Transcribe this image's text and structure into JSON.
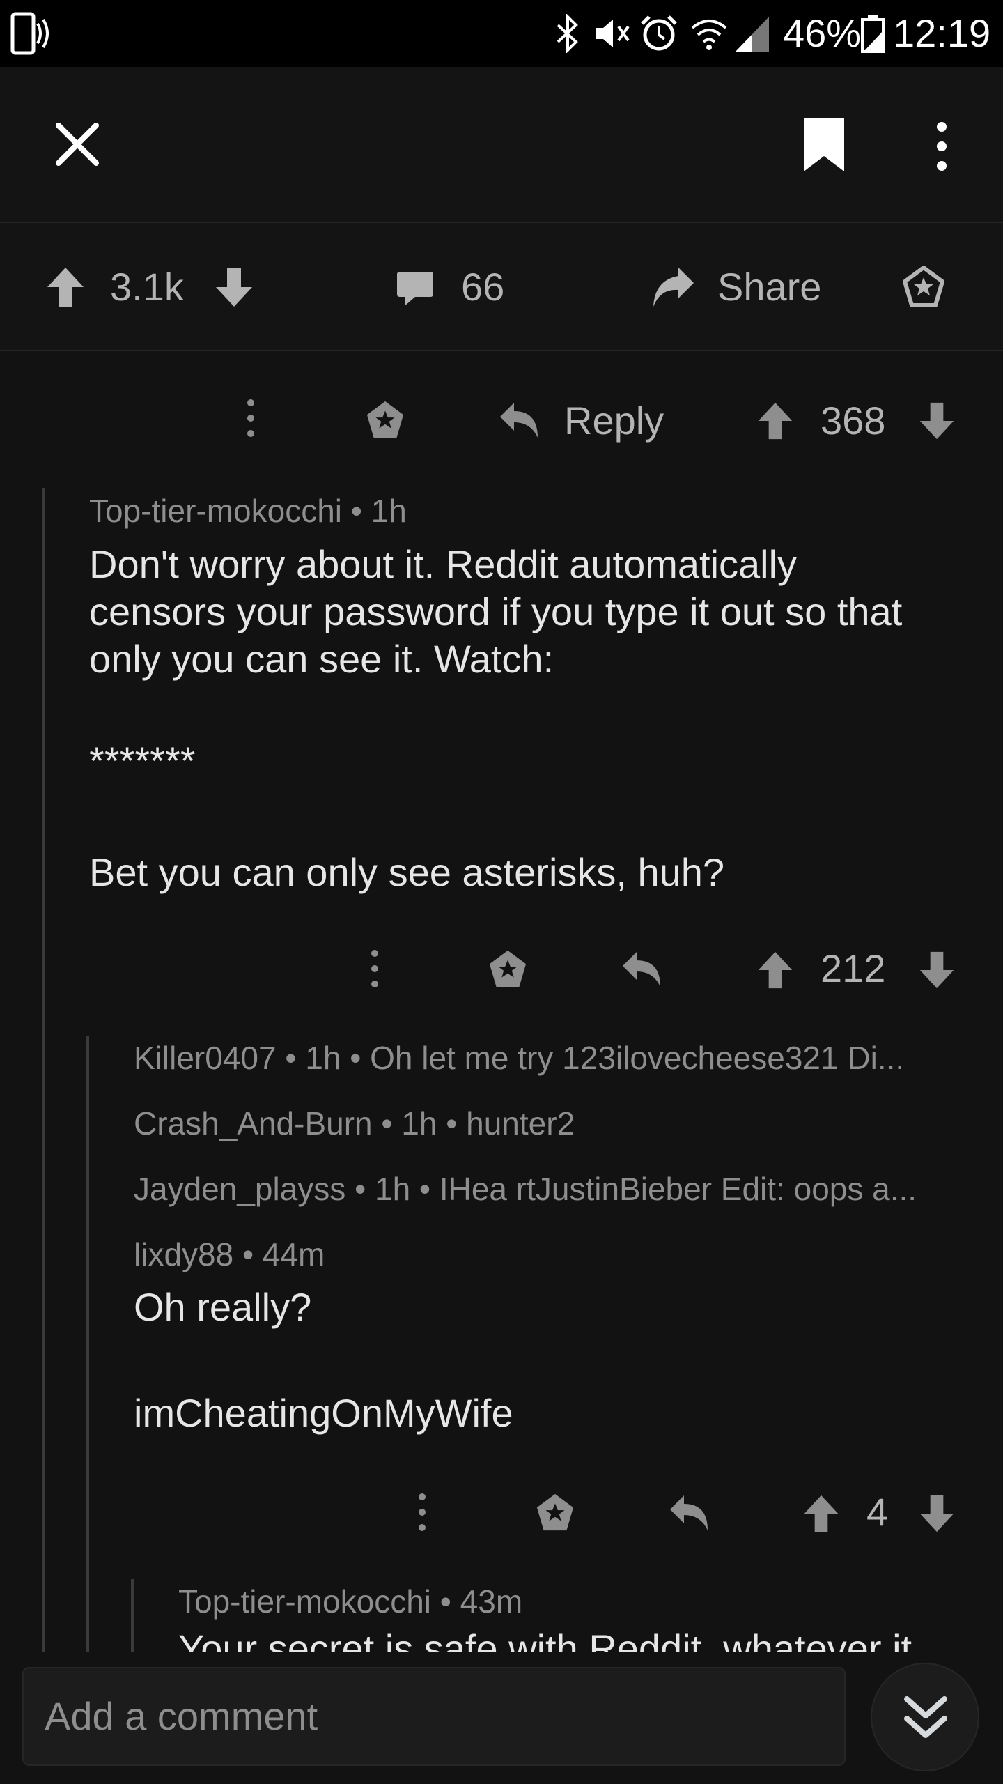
{
  "status_bar": {
    "battery": "46%",
    "time": "12:19"
  },
  "post_actions": {
    "score": "3.1k",
    "comments": "66",
    "share_label": "Share"
  },
  "comment_top": {
    "reply_label": "Reply",
    "score": "368"
  },
  "comment_main": {
    "author": "Top-tier-mokocchi",
    "age": "1h",
    "paragraphs": [
      "Don't worry about it. Reddit automatically",
      "censors your password if you type it out so that",
      "only you can see it. Watch:",
      "*******",
      "Bet you can only see asterisks, huh?"
    ],
    "score": "212"
  },
  "collapsed_replies": [
    {
      "author": "Killer0407",
      "age": "1h",
      "preview": "Oh let me try 123ilovecheese321 Di..."
    },
    {
      "author": "Crash_And-Burn",
      "age": "1h",
      "preview": "hunter2"
    },
    {
      "author": "Jayden_playss",
      "age": "1h",
      "preview": "IHea rtJustinBieber Edit: oops a..."
    }
  ],
  "reply_lixdy": {
    "author": "lixdy88",
    "age": "44m",
    "paragraphs": [
      "Oh really?",
      "imCheatingOnMyWife"
    ],
    "score": "4"
  },
  "reply_nested": {
    "author": "Top-tier-mokocchi",
    "age": "43m",
    "preview": "Your secret is safe with Reddit, whatever it"
  },
  "bottom": {
    "comment_placeholder": "Add a comment"
  },
  "colors": {
    "background": "#121212",
    "text": "#d7dadc",
    "muted": "#8e8e8e",
    "icon": "#b4b4b4"
  }
}
